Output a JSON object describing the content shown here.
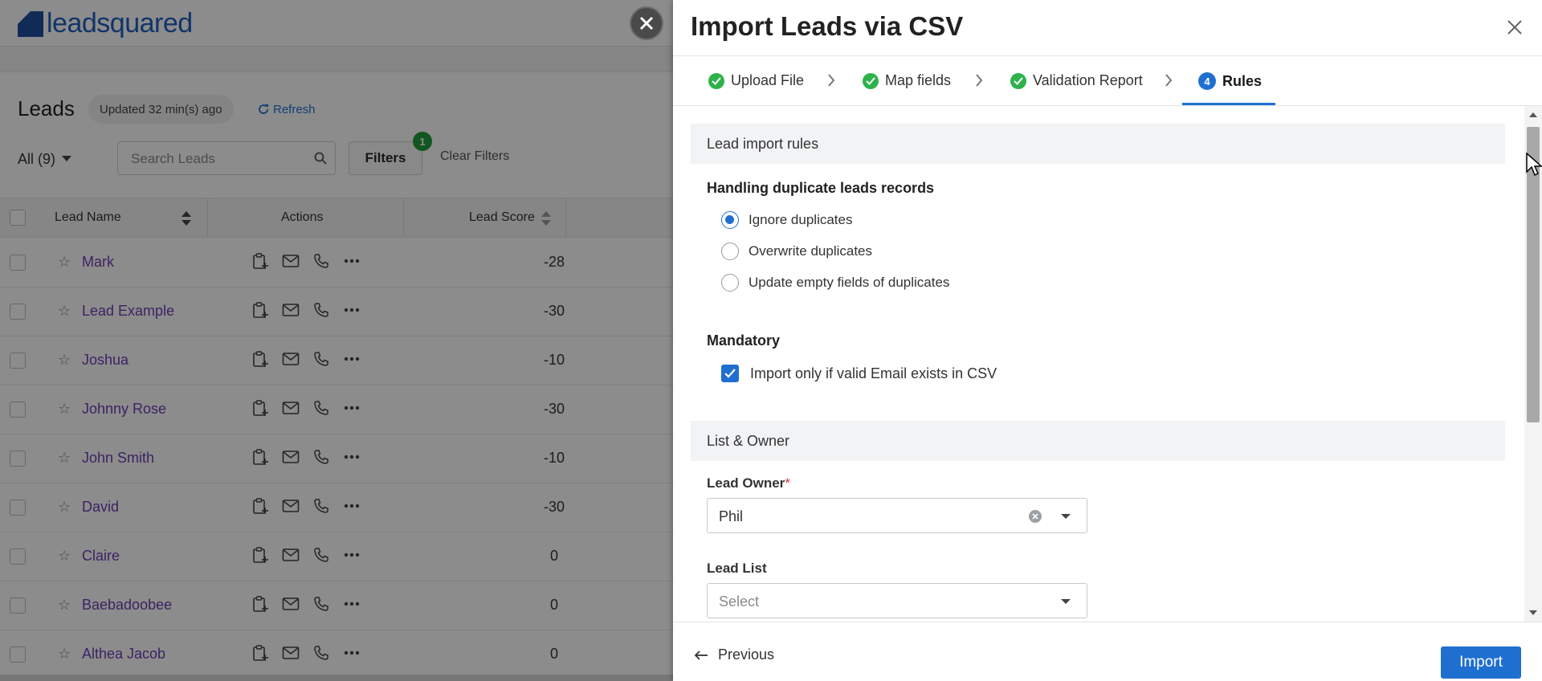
{
  "background": {
    "brand": "leadsquared",
    "leads_title": "Leads",
    "updated_text": "Updated 32 min(s) ago",
    "refresh_label": "Refresh",
    "all_filter": "All (9)",
    "search_placeholder": "Search Leads",
    "filters_label": "Filters",
    "filters_count": "1",
    "clear_filters": "Clear Filters",
    "columns": {
      "name": "Lead Name",
      "actions": "Actions",
      "score": "Lead Score"
    },
    "rows": [
      {
        "name": "Mark",
        "score": "-28"
      },
      {
        "name": "Lead Example",
        "score": "-30"
      },
      {
        "name": "Joshua",
        "score": "-10"
      },
      {
        "name": "Johnny Rose",
        "score": "-30"
      },
      {
        "name": "John Smith",
        "score": "-10"
      },
      {
        "name": "David",
        "score": "-30"
      },
      {
        "name": "Claire",
        "score": "0"
      },
      {
        "name": "Baebadoobee",
        "score": "0"
      },
      {
        "name": "Althea Jacob",
        "score": "0"
      }
    ]
  },
  "dialog": {
    "title": "Import Leads via CSV",
    "steps": [
      {
        "label": "Upload File",
        "state": "done"
      },
      {
        "label": "Map fields",
        "state": "done"
      },
      {
        "label": "Validation Report",
        "state": "done"
      },
      {
        "label": "Rules",
        "state": "active",
        "number": "4"
      }
    ],
    "sections": {
      "rules_header": "Lead import rules",
      "duplicates_label": "Handling duplicate leads records",
      "duplicate_options": [
        {
          "label": "Ignore duplicates",
          "selected": true
        },
        {
          "label": "Overwrite duplicates",
          "selected": false
        },
        {
          "label": "Update empty fields of duplicates",
          "selected": false
        }
      ],
      "mandatory_label": "Mandatory",
      "mandatory_option": "Import only if valid Email exists in CSV",
      "list_owner_header": "List & Owner",
      "lead_owner_label": "Lead Owner",
      "lead_owner_required": "*",
      "lead_owner_value": "Phil",
      "lead_list_label": "Lead List",
      "lead_list_placeholder": "Select"
    },
    "footer": {
      "previous": "Previous",
      "import": "Import"
    }
  },
  "colors": {
    "primary": "#1f6fd1",
    "success": "#2eb24a",
    "lead_link": "#6c3fb5"
  }
}
